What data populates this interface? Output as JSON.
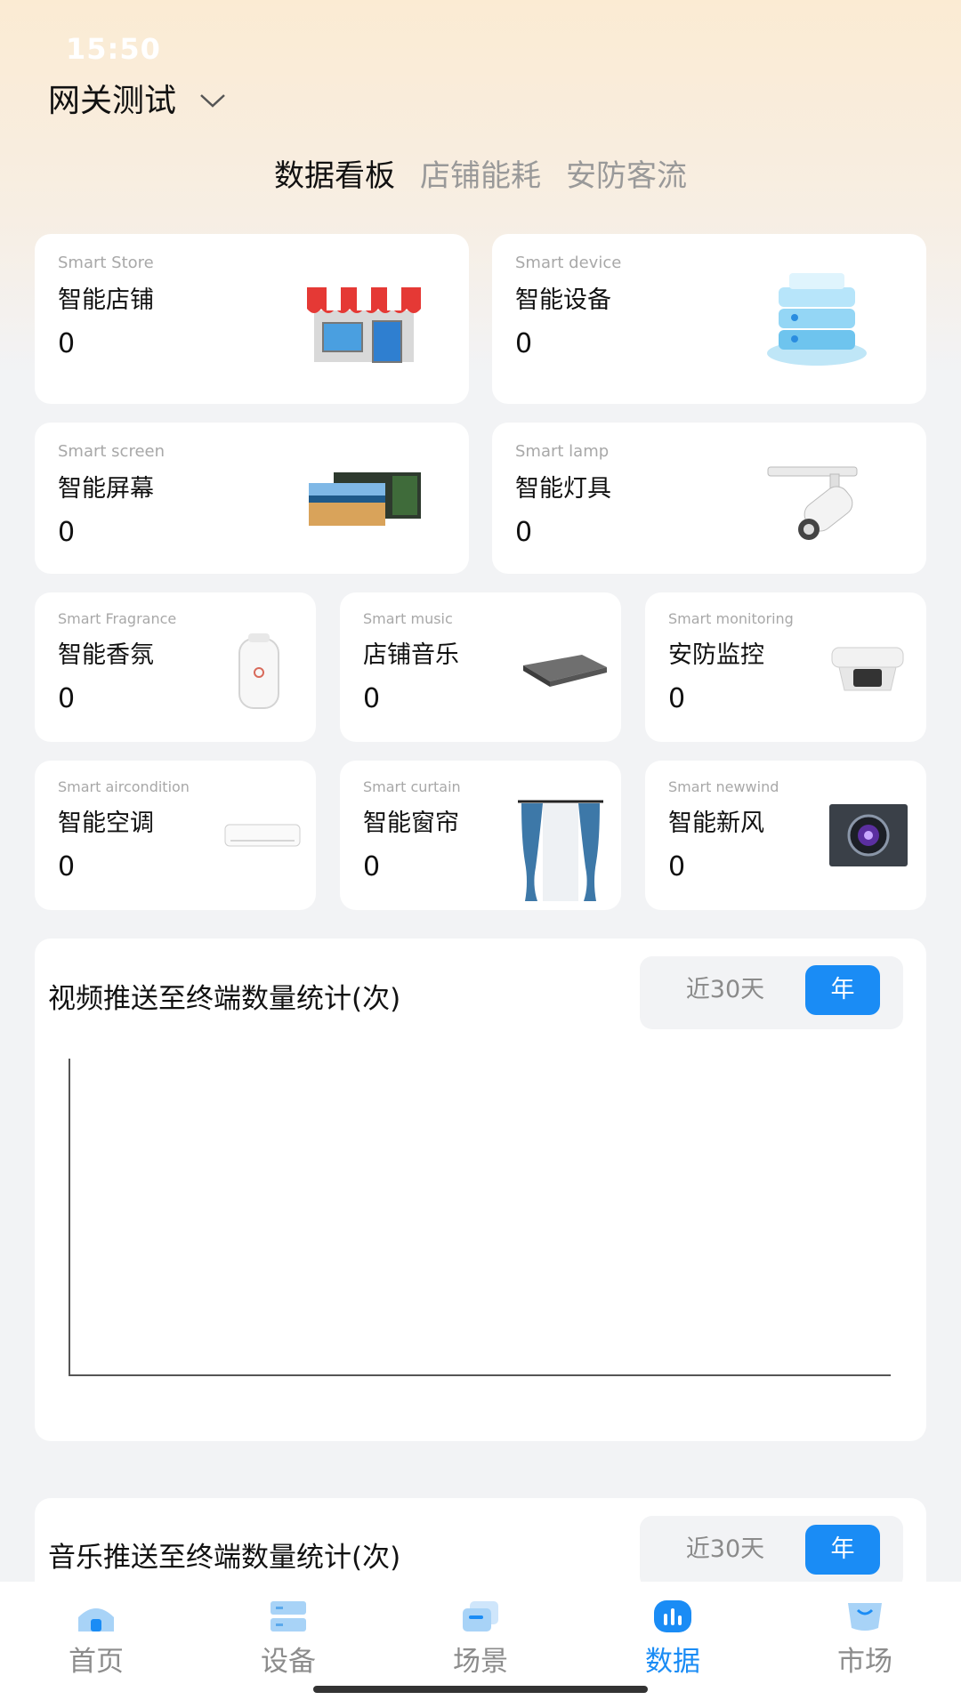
{
  "status_bar": {
    "time": "15:50"
  },
  "header": {
    "gateway_name": "网关测试"
  },
  "tabs": [
    {
      "label": "数据看板",
      "active": true
    },
    {
      "label": "店铺能耗",
      "active": false
    },
    {
      "label": "安防客流",
      "active": false
    }
  ],
  "cards": [
    {
      "en": "Smart Store",
      "cn": "智能店铺",
      "count": "0",
      "icon": "store-icon"
    },
    {
      "en": "Smart device",
      "cn": "智能设备",
      "count": "0",
      "icon": "server-icon"
    },
    {
      "en": "Smart screen",
      "cn": "智能屏幕",
      "count": "0",
      "icon": "screen-icon"
    },
    {
      "en": "Smart lamp",
      "cn": "智能灯具",
      "count": "0",
      "icon": "lamp-icon"
    },
    {
      "en": "Smart Fragrance",
      "cn": "智能香氛",
      "count": "0",
      "icon": "fragrance-icon"
    },
    {
      "en": "Smart music",
      "cn": "店铺音乐",
      "count": "0",
      "icon": "music-box-icon"
    },
    {
      "en": "Smart monitoring",
      "cn": "安防监控",
      "count": "0",
      "icon": "camera-icon"
    },
    {
      "en": "Smart aircondition",
      "cn": "智能空调",
      "count": "0",
      "icon": "aircon-icon"
    },
    {
      "en": "Smart curtain",
      "cn": "智能窗帘",
      "count": "0",
      "icon": "curtain-icon"
    },
    {
      "en": "Smart newwind",
      "cn": "智能新风",
      "count": "0",
      "icon": "fresh-air-icon"
    }
  ],
  "charts": [
    {
      "title": "视频推送至终端数量统计(次)",
      "range_options": [
        "近30天",
        "年"
      ],
      "selected": "年"
    },
    {
      "title": "音乐推送至终端数量统计(次)",
      "range_options": [
        "近30天",
        "年"
      ],
      "selected": "年"
    }
  ],
  "chart_data": {
    "type": "line",
    "title": "视频推送至终端数量统计(次)",
    "series": []
  },
  "bottom_nav": [
    {
      "label": "首页",
      "icon": "home-icon",
      "active": false
    },
    {
      "label": "设备",
      "icon": "device-icon",
      "active": false
    },
    {
      "label": "场景",
      "icon": "scene-icon",
      "active": false
    },
    {
      "label": "数据",
      "icon": "data-chart-icon",
      "active": true
    },
    {
      "label": "市场",
      "icon": "market-bag-icon",
      "active": false
    }
  ],
  "colors": {
    "accent": "#1a8cf5",
    "background": "#f2f3f5",
    "header_gradient": "#fbebd3"
  }
}
